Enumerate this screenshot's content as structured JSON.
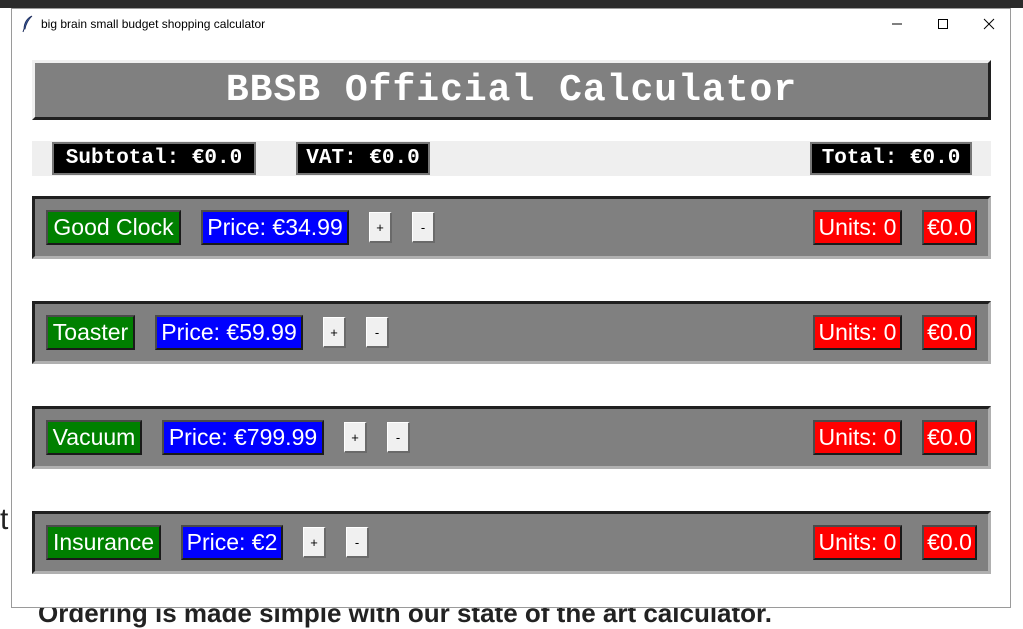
{
  "background": {
    "left_fragment": "t",
    "bottom_text": "Ordering is made simple with our state of the art calculator."
  },
  "window": {
    "title": "big brain small budget shopping calculator",
    "minimize_glyph": "—",
    "maximize_glyph": "☐",
    "close_glyph": "✕"
  },
  "header": {
    "title": "BBSB Official Calculator"
  },
  "summary": {
    "subtotal": "Subtotal: €0.0",
    "vat": "VAT: €0.0",
    "total": "Total: €0.0"
  },
  "products": [
    {
      "name": "Good Clock",
      "price": "Price: €34.99",
      "plus": "+",
      "minus": "-",
      "units": "Units: 0",
      "cost": "€0.0"
    },
    {
      "name": "Toaster",
      "price": "Price: €59.99",
      "plus": "+",
      "minus": "-",
      "units": "Units: 0",
      "cost": "€0.0"
    },
    {
      "name": "Vacuum",
      "price": "Price: €799.99",
      "plus": "+",
      "minus": "-",
      "units": "Units: 0",
      "cost": "€0.0"
    },
    {
      "name": "Insurance",
      "price": "Price: €2",
      "plus": "+",
      "minus": "-",
      "units": "Units: 0",
      "cost": "€0.0"
    }
  ],
  "colors": {
    "header_bg": "#808080",
    "name_bg": "#008000",
    "price_bg": "#0000ff",
    "units_bg": "#ff0000",
    "summary_bg": "#000000"
  },
  "icons": {
    "app_icon": "feather-icon"
  }
}
